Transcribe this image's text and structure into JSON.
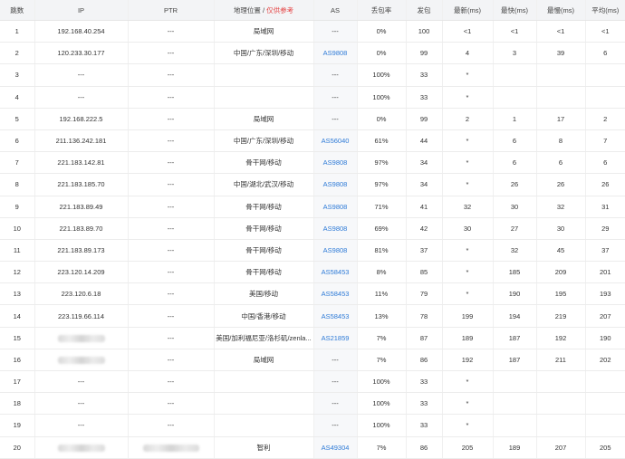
{
  "headers": {
    "hop": "跳数",
    "ip": "IP",
    "ptr": "PTR",
    "location": "地理位置",
    "location_sep": "/",
    "location_hint": "仅供参考",
    "as": "AS",
    "loss": "丢包率",
    "sent": "发包",
    "last": "最新(ms)",
    "best": "最快(ms)",
    "worst": "最慢(ms)",
    "avg": "平均(ms)"
  },
  "rows": [
    {
      "hop": "1",
      "ip": "192.168.40.254",
      "ptr": "---",
      "loc": "局域网",
      "as": "---",
      "loss": "0%",
      "sent": "100",
      "last": "<1",
      "best": "<1",
      "worst": "<1",
      "avg": "<1"
    },
    {
      "hop": "2",
      "ip": "120.233.30.177",
      "ptr": "---",
      "loc": "中国/广东/深圳/移动",
      "as": "AS9808",
      "loss": "0%",
      "sent": "99",
      "last": "4",
      "best": "3",
      "worst": "39",
      "avg": "6"
    },
    {
      "hop": "3",
      "ip": "---",
      "ptr": "---",
      "loc": "",
      "as": "---",
      "loss": "100%",
      "sent": "33",
      "last": "*",
      "best": "",
      "worst": "",
      "avg": ""
    },
    {
      "hop": "4",
      "ip": "---",
      "ptr": "---",
      "loc": "",
      "as": "---",
      "loss": "100%",
      "sent": "33",
      "last": "*",
      "best": "",
      "worst": "",
      "avg": ""
    },
    {
      "hop": "5",
      "ip": "192.168.222.5",
      "ptr": "---",
      "loc": "局域网",
      "as": "---",
      "loss": "0%",
      "sent": "99",
      "last": "2",
      "best": "1",
      "worst": "17",
      "avg": "2"
    },
    {
      "hop": "6",
      "ip": "211.136.242.181",
      "ptr": "---",
      "loc": "中国/广东/深圳/移动",
      "as": "AS56040",
      "loss": "61%",
      "sent": "44",
      "last": "*",
      "best": "6",
      "worst": "8",
      "avg": "7"
    },
    {
      "hop": "7",
      "ip": "221.183.142.81",
      "ptr": "---",
      "loc": "骨干网/移动",
      "as": "AS9808",
      "loss": "97%",
      "sent": "34",
      "last": "*",
      "best": "6",
      "worst": "6",
      "avg": "6"
    },
    {
      "hop": "8",
      "ip": "221.183.185.70",
      "ptr": "---",
      "loc": "中国/湖北/武汉/移动",
      "as": "AS9808",
      "loss": "97%",
      "sent": "34",
      "last": "*",
      "best": "26",
      "worst": "26",
      "avg": "26"
    },
    {
      "hop": "9",
      "ip": "221.183.89.49",
      "ptr": "---",
      "loc": "骨干网/移动",
      "as": "AS9808",
      "loss": "71%",
      "sent": "41",
      "last": "32",
      "best": "30",
      "worst": "32",
      "avg": "31"
    },
    {
      "hop": "10",
      "ip": "221.183.89.70",
      "ptr": "---",
      "loc": "骨干网/移动",
      "as": "AS9808",
      "loss": "69%",
      "sent": "42",
      "last": "30",
      "best": "27",
      "worst": "30",
      "avg": "29"
    },
    {
      "hop": "11",
      "ip": "221.183.89.173",
      "ptr": "---",
      "loc": "骨干网/移动",
      "as": "AS9808",
      "loss": "81%",
      "sent": "37",
      "last": "*",
      "best": "32",
      "worst": "45",
      "avg": "37"
    },
    {
      "hop": "12",
      "ip": "223.120.14.209",
      "ptr": "---",
      "loc": "骨干网/移动",
      "as": "AS58453",
      "loss": "8%",
      "sent": "85",
      "last": "*",
      "best": "185",
      "worst": "209",
      "avg": "201"
    },
    {
      "hop": "13",
      "ip": "223.120.6.18",
      "ptr": "---",
      "loc": "美国/移动",
      "as": "AS58453",
      "loss": "11%",
      "sent": "79",
      "last": "*",
      "best": "190",
      "worst": "195",
      "avg": "193"
    },
    {
      "hop": "14",
      "ip": "223.119.66.114",
      "ptr": "---",
      "loc": "中国/香港/移动",
      "as": "AS58453",
      "loss": "13%",
      "sent": "78",
      "last": "199",
      "best": "194",
      "worst": "219",
      "avg": "207"
    },
    {
      "hop": "15",
      "ip": "",
      "ip_redacted": true,
      "ptr": "---",
      "loc": "美国/加利福尼亚/洛杉矶/zenla...",
      "as": "AS21859",
      "loss": "7%",
      "sent": "87",
      "last": "189",
      "best": "187",
      "worst": "192",
      "avg": "190"
    },
    {
      "hop": "16",
      "ip": "",
      "ip_redacted": true,
      "ptr": "---",
      "loc": "局域网",
      "as": "---",
      "loss": "7%",
      "sent": "86",
      "last": "192",
      "best": "187",
      "worst": "211",
      "avg": "202"
    },
    {
      "hop": "17",
      "ip": "---",
      "ptr": "---",
      "loc": "",
      "as": "---",
      "loss": "100%",
      "sent": "33",
      "last": "*",
      "best": "",
      "worst": "",
      "avg": ""
    },
    {
      "hop": "18",
      "ip": "---",
      "ptr": "---",
      "loc": "",
      "as": "---",
      "loss": "100%",
      "sent": "33",
      "last": "*",
      "best": "",
      "worst": "",
      "avg": ""
    },
    {
      "hop": "19",
      "ip": "---",
      "ptr": "---",
      "loc": "",
      "as": "---",
      "loss": "100%",
      "sent": "33",
      "last": "*",
      "best": "",
      "worst": "",
      "avg": ""
    },
    {
      "hop": "20",
      "ip": "",
      "ip_redacted": true,
      "ptr": "",
      "ptr_redacted": true,
      "loc": "智利",
      "as": "AS49304",
      "loss": "7%",
      "sent": "86",
      "last": "205",
      "best": "189",
      "worst": "207",
      "avg": "205"
    }
  ],
  "colors": {
    "as_link": "#2f7bd7",
    "hint": "#e54545",
    "header_bg": "#f3f4f6"
  }
}
